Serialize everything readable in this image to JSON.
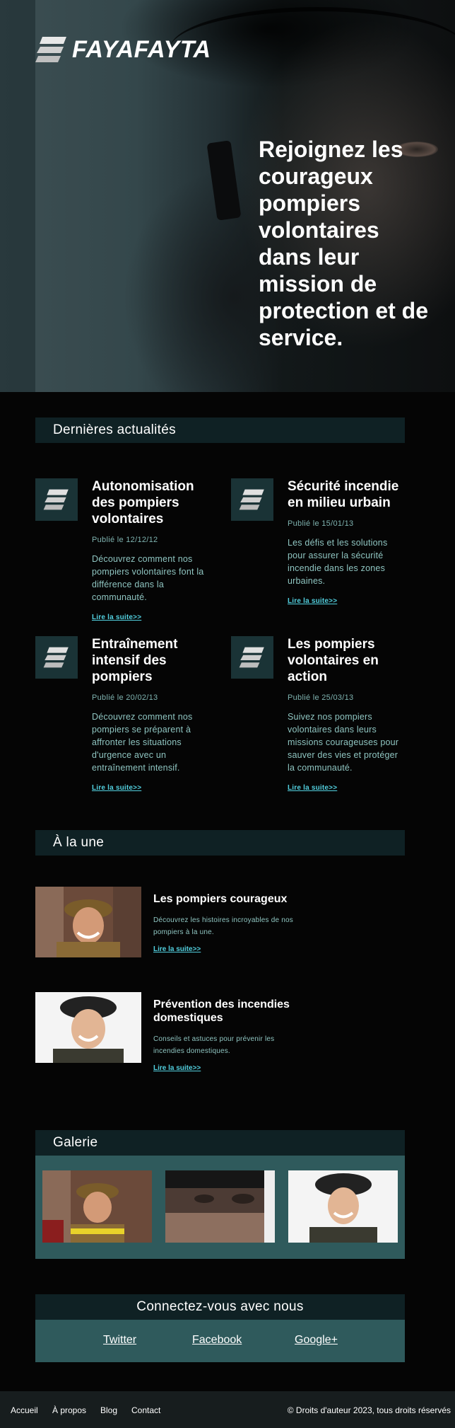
{
  "brand": {
    "name": "FAYAFAYTA"
  },
  "hero": {
    "title": "Rejoignez les courageux pompiers volontaires dans leur mission de protection et de service."
  },
  "news": {
    "heading": "Dernières actualités",
    "items": [
      {
        "title": "Autonomisation des pompiers volontaires",
        "date": "Publié le 12/12/12",
        "desc": "Découvrez comment nos pompiers volontaires font la différence dans la communauté.",
        "link": "Lire la suite>>"
      },
      {
        "title": "Sécurité incendie en milieu urbain",
        "date": "Publié le 15/01/13",
        "desc": "Les défis et les solutions pour assurer la sécurité incendie dans les zones urbaines.",
        "link": "Lire la suite>>"
      },
      {
        "title": "Entraînement intensif des pompiers",
        "date": "Publié le 20/02/13",
        "desc": "Découvrez comment nos pompiers se préparent à affronter les situations d'urgence avec un entraînement intensif.",
        "link": "Lire la suite>>"
      },
      {
        "title": "Les pompiers volontaires en action",
        "date": "Publié le 25/03/13",
        "desc": "Suivez nos pompiers volontaires dans leurs missions courageuses pour sauver des vies et protéger la communauté.",
        "link": "Lire la suite>>"
      }
    ]
  },
  "featured": {
    "heading": "À la une",
    "items": [
      {
        "title": "Les pompiers courageux",
        "desc": "Découvrez les histoires incroyables de nos pompiers à la une.",
        "link": "Lire la suite>>"
      },
      {
        "title": "Prévention des incendies domestiques",
        "desc": "Conseils et astuces pour prévenir les incendies domestiques.",
        "link": "Lire la suite>>"
      }
    ]
  },
  "gallery": {
    "heading": "Galerie"
  },
  "connect": {
    "heading": "Connectez-vous avec nous",
    "links": [
      "Twitter",
      "Facebook",
      "Google+"
    ]
  },
  "footer": {
    "links": [
      "Accueil",
      "À propos",
      "Blog",
      "Contact"
    ],
    "copyright": "© Droits d'auteur 2023, tous droits réservés"
  },
  "colors": {
    "accent": "#52d0df",
    "header_bar": "#0f2124",
    "panel": "#2f5a5c",
    "text_muted": "#8fc5c1"
  }
}
